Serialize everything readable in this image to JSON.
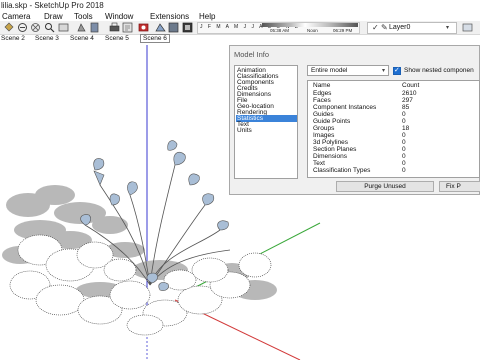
{
  "window": {
    "title": "lilia.skp - SketchUp Pro 2018"
  },
  "menu": [
    "Camera",
    "Draw",
    "Tools",
    "Window",
    "Extensions",
    "Help"
  ],
  "shadows": {
    "months": "J F M A M J J A S O N D",
    "time_start": "05:38 AM",
    "time_mid": "Noon",
    "time_end": "06:29 PM"
  },
  "layer": {
    "current": "Layer0"
  },
  "scenes": [
    "Scene 2",
    "Scene 3",
    "Scene 4",
    "Scene 5",
    "Scene 6"
  ],
  "dialog": {
    "title": "Model Info",
    "nav": [
      "Animation",
      "Classifications",
      "Components",
      "Credits",
      "Dimensions",
      "File",
      "Geo-location",
      "Rendering",
      "Statistics",
      "Text",
      "Units"
    ],
    "active_nav": "Statistics",
    "scope": "Entire model",
    "show_nested_label": "Show nested componen",
    "columns": {
      "name": "Name",
      "count": "Count"
    },
    "stats": [
      {
        "name": "Edges",
        "count": "2610"
      },
      {
        "name": "Faces",
        "count": "297"
      },
      {
        "name": "Component Instances",
        "count": "85"
      },
      {
        "name": "Guides",
        "count": "0"
      },
      {
        "name": "Guide Points",
        "count": "0"
      },
      {
        "name": "Groups",
        "count": "18"
      },
      {
        "name": "Images",
        "count": "0"
      },
      {
        "name": "3d Polylines",
        "count": "0"
      },
      {
        "name": "Section Planes",
        "count": "0"
      },
      {
        "name": "Dimensions",
        "count": "0"
      },
      {
        "name": "Text",
        "count": "0"
      },
      {
        "name": "Classification Types",
        "count": "0"
      }
    ],
    "purge_button": "Purge Unused",
    "fix_button": "Fix P"
  },
  "colors": {
    "accent": "#3b83d9",
    "axis_red": "#d23a3a",
    "axis_green": "#3aa83a",
    "axis_blue": "#3a3ad2"
  }
}
